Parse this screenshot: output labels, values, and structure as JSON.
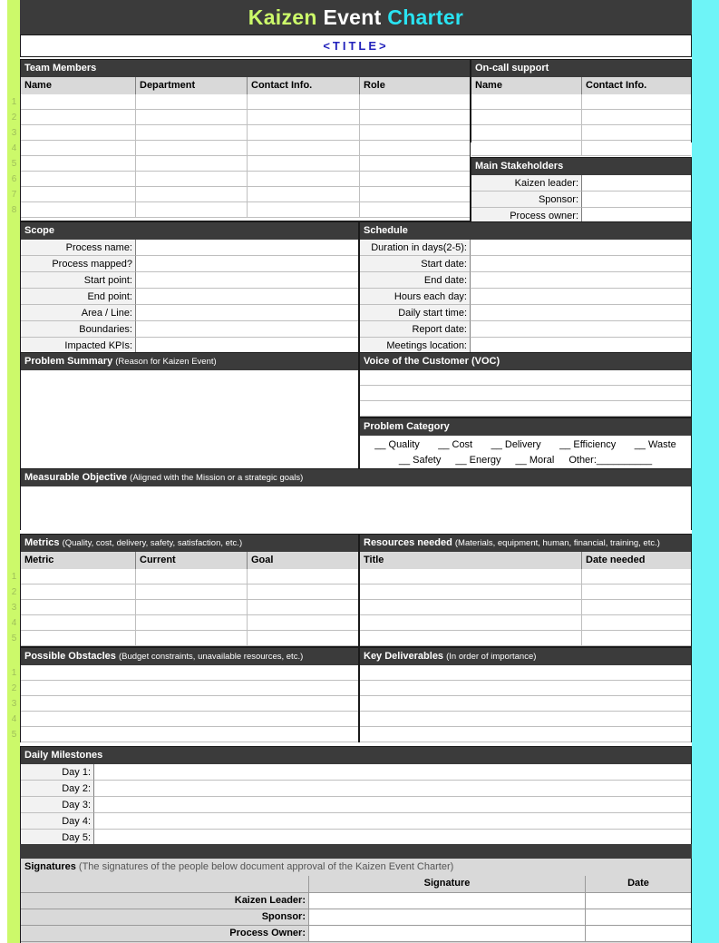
{
  "header": {
    "title_part1": "Kaizen",
    "title_part2": "Event",
    "title_part3": "Charter",
    "title_placeholder": "<TITLE>",
    "colors": {
      "kaizen": "#ccf96a",
      "event": "#ffffff",
      "charter": "#29e3f2",
      "header_bg": "#3b3b3b",
      "left_stripe": "#ccf96a",
      "right_stripe": "#6ef4f7"
    }
  },
  "team_members": {
    "section_title": "Team Members",
    "columns": [
      "Name",
      "Department",
      "Contact Info.",
      "Role"
    ],
    "row_numbers": [
      "1",
      "2",
      "3",
      "4",
      "5",
      "6",
      "7",
      "8"
    ],
    "rows": [
      [
        "",
        "",
        "",
        ""
      ],
      [
        "",
        "",
        "",
        ""
      ],
      [
        "",
        "",
        "",
        ""
      ],
      [
        "",
        "",
        "",
        ""
      ],
      [
        "",
        "",
        "",
        ""
      ],
      [
        "",
        "",
        "",
        ""
      ],
      [
        "",
        "",
        "",
        ""
      ],
      [
        "",
        "",
        "",
        ""
      ]
    ]
  },
  "on_call_support": {
    "section_title": "On-call support",
    "columns": [
      "Name",
      "Contact Info."
    ],
    "rows": [
      [
        "",
        ""
      ],
      [
        "",
        ""
      ],
      [
        "",
        ""
      ],
      [
        "",
        ""
      ]
    ]
  },
  "main_stakeholders": {
    "section_title": "Main Stakeholders",
    "fields": [
      {
        "label": "Kaizen leader:",
        "value": ""
      },
      {
        "label": "Sponsor:",
        "value": ""
      },
      {
        "label": "Process owner:",
        "value": ""
      }
    ]
  },
  "scope": {
    "section_title": "Scope",
    "fields": [
      {
        "label": "Process name:",
        "value": ""
      },
      {
        "label": "Process mapped?",
        "value": ""
      },
      {
        "label": "Start point:",
        "value": ""
      },
      {
        "label": "End point:",
        "value": ""
      },
      {
        "label": "Area / Line:",
        "value": ""
      },
      {
        "label": "Boundaries:",
        "value": ""
      },
      {
        "label": "Impacted KPIs:",
        "value": ""
      }
    ]
  },
  "schedule": {
    "section_title": "Schedule",
    "fields": [
      {
        "label": "Duration in days(2-5):",
        "value": ""
      },
      {
        "label": "Start date:",
        "value": ""
      },
      {
        "label": "End date:",
        "value": ""
      },
      {
        "label": "Hours each day:",
        "value": ""
      },
      {
        "label": "Daily start time:",
        "value": ""
      },
      {
        "label": "Report date:",
        "value": ""
      },
      {
        "label": "Meetings location:",
        "value": ""
      }
    ]
  },
  "problem_summary": {
    "section_title": "Problem Summary",
    "section_subtitle": "(Reason for Kaizen Event)",
    "value": ""
  },
  "voice_of_customer": {
    "section_title": "Voice of the Customer (VOC)",
    "rows": [
      "",
      "",
      ""
    ]
  },
  "problem_category": {
    "section_title": "Problem Category",
    "row1": [
      "__ Quality",
      "__ Cost",
      "__ Delivery",
      "__ Efficiency",
      "__ Waste"
    ],
    "row2": [
      "__ Safety",
      "__ Energy",
      "__ Moral"
    ],
    "other_label": "Other:",
    "other_value": "__________"
  },
  "measurable_objective": {
    "section_title": "Measurable Objective",
    "section_subtitle": "(Aligned with the Mission or a strategic goals)",
    "value": ""
  },
  "metrics": {
    "section_title": "Metrics",
    "section_subtitle": "(Quality, cost, delivery, safety, satisfaction, etc.)",
    "columns": [
      "Metric",
      "Current",
      "Goal"
    ],
    "row_numbers": [
      "1",
      "2",
      "3",
      "4",
      "5"
    ],
    "rows": [
      [
        "",
        "",
        ""
      ],
      [
        "",
        "",
        ""
      ],
      [
        "",
        "",
        ""
      ],
      [
        "",
        "",
        ""
      ],
      [
        "",
        "",
        ""
      ]
    ]
  },
  "resources_needed": {
    "section_title": "Resources needed",
    "section_subtitle": "(Materials, equipment, human, financial, training, etc.)",
    "columns": [
      "Title",
      "Date needed"
    ],
    "rows": [
      [
        "",
        ""
      ],
      [
        "",
        ""
      ],
      [
        "",
        ""
      ],
      [
        "",
        ""
      ],
      [
        "",
        ""
      ]
    ]
  },
  "possible_obstacles": {
    "section_title": "Possible Obstacles",
    "section_subtitle": "(Budget constraints, unavailable resources, etc.)",
    "row_numbers": [
      "1",
      "2",
      "3",
      "4",
      "5"
    ],
    "rows": [
      "",
      "",
      "",
      "",
      ""
    ]
  },
  "key_deliverables": {
    "section_title": "Key Deliverables",
    "section_subtitle": "(In order of importance)",
    "rows": [
      "",
      "",
      "",
      "",
      ""
    ]
  },
  "daily_milestones": {
    "section_title": "Daily Milestones",
    "fields": [
      {
        "label": "Day 1:",
        "value": ""
      },
      {
        "label": "Day 2:",
        "value": ""
      },
      {
        "label": "Day 3:",
        "value": ""
      },
      {
        "label": "Day 4:",
        "value": ""
      },
      {
        "label": "Day 5:",
        "value": ""
      }
    ]
  },
  "signatures": {
    "section_title": "Signatures",
    "section_subtitle": "(The signatures of the people below document approval of the Kaizen Event Charter)",
    "columns": [
      "",
      "Signature",
      "Date"
    ],
    "rows": [
      {
        "label": "Kaizen Leader:",
        "signature": "",
        "date": ""
      },
      {
        "label": "Sponsor:",
        "signature": "",
        "date": ""
      },
      {
        "label": "Process Owner:",
        "signature": "",
        "date": ""
      }
    ]
  }
}
